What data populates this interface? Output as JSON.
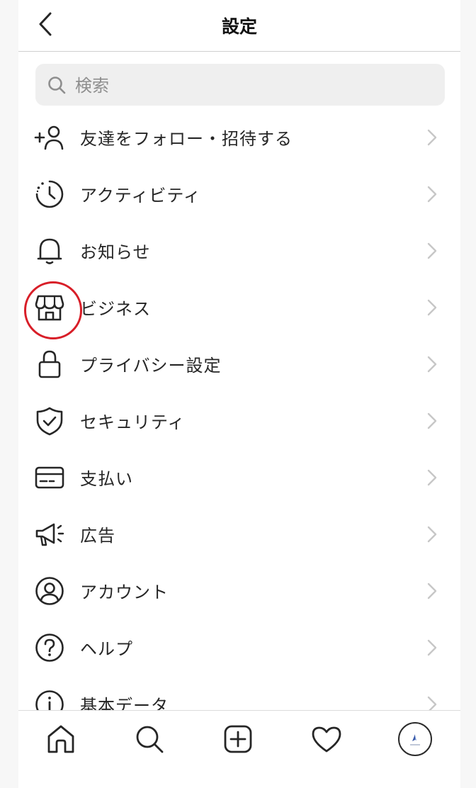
{
  "header": {
    "title": "設定",
    "back_icon": "chevron-left-icon"
  },
  "search": {
    "placeholder": "検索",
    "value": "",
    "icon": "search-icon"
  },
  "menu": [
    {
      "label": "友達をフォロー・招待する",
      "icon": "add-person-icon"
    },
    {
      "label": "アクティビティ",
      "icon": "activity-clock-icon"
    },
    {
      "label": "お知らせ",
      "icon": "bell-icon"
    },
    {
      "label": "ビジネス",
      "icon": "shop-icon",
      "highlighted": true
    },
    {
      "label": "プライバシー設定",
      "icon": "lock-icon"
    },
    {
      "label": "セキュリティ",
      "icon": "shield-icon"
    },
    {
      "label": "支払い",
      "icon": "credit-card-icon"
    },
    {
      "label": "広告",
      "icon": "megaphone-icon"
    },
    {
      "label": "アカウント",
      "icon": "account-icon"
    },
    {
      "label": "ヘルプ",
      "icon": "help-icon"
    },
    {
      "label": "基本データ",
      "icon": "info-icon"
    }
  ],
  "tabbar": [
    "home-icon",
    "search-icon",
    "new-post-icon",
    "heart-icon",
    "profile-avatar"
  ],
  "colors": {
    "highlight": "#d81e28",
    "text": "#262626",
    "chevron": "#c7c7c7",
    "search_bg": "#efefef"
  }
}
